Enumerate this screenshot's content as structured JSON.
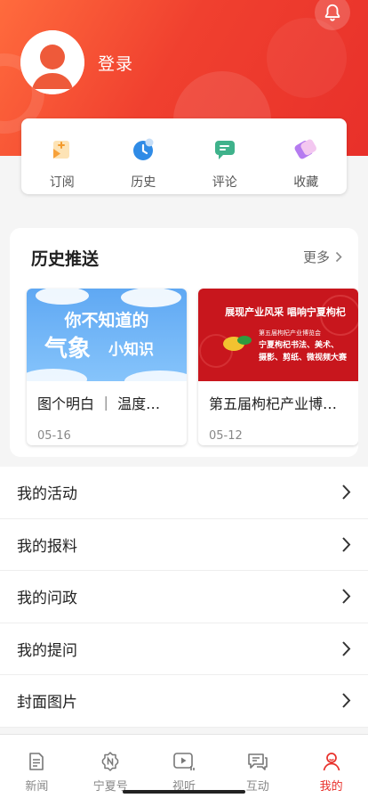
{
  "profile": {
    "login_label": "登录"
  },
  "quick_actions": [
    {
      "label": "订阅",
      "icon": "subscribe-icon"
    },
    {
      "label": "历史",
      "icon": "history-clock-icon"
    },
    {
      "label": "评论",
      "icon": "comment-icon"
    },
    {
      "label": "收藏",
      "icon": "favorite-icon"
    }
  ],
  "history_push": {
    "title": "历史推送",
    "more_label": "更多",
    "items": [
      {
        "title": "图个明白 ｜ 温度…",
        "date": "05-16",
        "thumb_text_line1": "你不知道的",
        "thumb_text_line2a": "气象",
        "thumb_text_line2b": "小知识"
      },
      {
        "title": "第五届枸杞产业博…",
        "date": "05-12",
        "thumb_text_line1": "展现产业风采 唱响宁夏枸杞",
        "thumb_text_line2": "第五届枸杞产业博览会",
        "thumb_text_line3": "宁夏枸杞书法、美术、",
        "thumb_text_line4": "摄影、剪纸、微视频大赛"
      }
    ]
  },
  "menu": [
    {
      "label": "我的活动"
    },
    {
      "label": "我的报料"
    },
    {
      "label": "我的问政"
    },
    {
      "label": "我的提问"
    },
    {
      "label": "封面图片"
    }
  ],
  "tabs": [
    {
      "label": "新闻",
      "icon": "news-icon"
    },
    {
      "label": "宁夏号",
      "icon": "ningxia-badge-icon"
    },
    {
      "label": "视听",
      "icon": "video-play-icon"
    },
    {
      "label": "互动",
      "icon": "chat-icon"
    },
    {
      "label": "我的",
      "icon": "person-icon",
      "active": true
    }
  ],
  "colors": {
    "accent": "#e8302a",
    "header_start": "#ff6b3d"
  }
}
